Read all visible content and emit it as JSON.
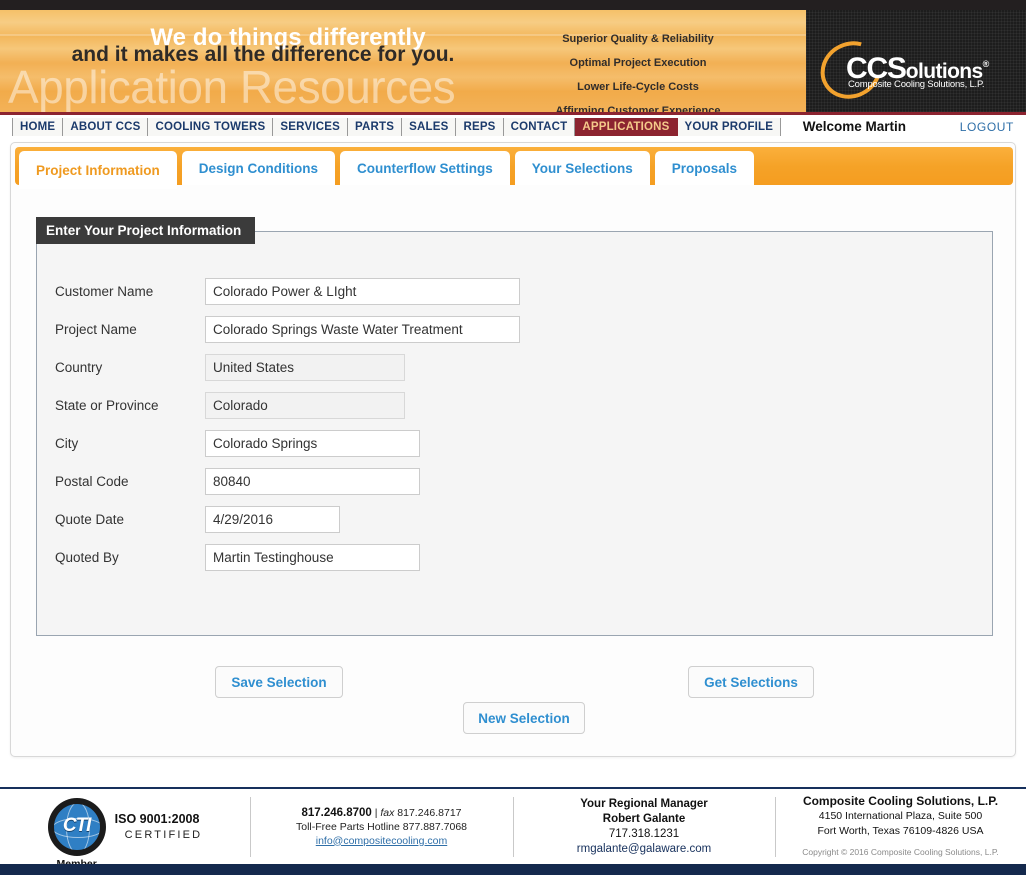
{
  "banner": {
    "headline_white": "We do things differently",
    "headline_dark": "and it makes all the difference for you.",
    "section_title": "Application Resources",
    "bullets": [
      "Superior Quality & Reliability",
      "Optimal Project Execution",
      "Lower Life-Cycle Costs",
      "Affirming Customer Experience"
    ],
    "logo": {
      "main": "CCS",
      "suffix": "olutions",
      "registered": "®",
      "subtitle": "Composite Cooling Solutions, L.P."
    }
  },
  "nav": {
    "items": [
      {
        "label": "HOME",
        "active": false
      },
      {
        "label": "ABOUT CCS",
        "active": false
      },
      {
        "label": "COOLING TOWERS",
        "active": false
      },
      {
        "label": "SERVICES",
        "active": false
      },
      {
        "label": "PARTS",
        "active": false
      },
      {
        "label": "SALES",
        "active": false
      },
      {
        "label": "REPS",
        "active": false
      },
      {
        "label": "CONTACT",
        "active": false
      },
      {
        "label": "APPLICATIONS",
        "active": true
      },
      {
        "label": "YOUR PROFILE",
        "active": false
      }
    ],
    "welcome": "Welcome Martin",
    "logout": "LOGOUT"
  },
  "tabs": [
    {
      "label": "Project Information",
      "active": true
    },
    {
      "label": "Design Conditions",
      "active": false
    },
    {
      "label": "Counterflow Settings",
      "active": false
    },
    {
      "label": "Your Selections",
      "active": false
    },
    {
      "label": "Proposals",
      "active": false
    }
  ],
  "panel": {
    "title": "Enter Your Project Information",
    "fields": [
      {
        "label": "Customer Name",
        "value": "Colorado Power & LIght",
        "readonly": false
      },
      {
        "label": "Project Name",
        "value": "Colorado Springs Waste Water Treatment",
        "readonly": false
      },
      {
        "label": "Country",
        "value": "United States",
        "readonly": true
      },
      {
        "label": "State or Province",
        "value": "Colorado",
        "readonly": true
      },
      {
        "label": "City",
        "value": "Colorado Springs",
        "readonly": false
      },
      {
        "label": "Postal Code",
        "value": "80840",
        "readonly": false
      },
      {
        "label": "Quote Date",
        "value": "4/29/2016",
        "readonly": false
      },
      {
        "label": "Quoted By",
        "value": "Martin Testinghouse",
        "readonly": false
      }
    ]
  },
  "buttons": {
    "save": "Save Selection",
    "new": "New Selection",
    "get": "Get Selections"
  },
  "footer": {
    "cti": {
      "letters": "CTI",
      "member": "Member",
      "iso": "ISO 9001:2008",
      "certified": "CERTIFIED"
    },
    "contact": {
      "phone": "817.246.8700",
      "fax_sep": " | ",
      "fax_label": "fax",
      "fax": " 817.246.8717",
      "hotline": "Toll-Free Parts Hotline 877.887.7068",
      "email": "info@compositecooling.com"
    },
    "manager": {
      "heading": "Your Regional Manager",
      "name": "Robert Galante",
      "phone": "717.318.1231",
      "email": "rmgalante@galaware.com"
    },
    "company": {
      "name": "Composite Cooling Solutions, L.P.",
      "address1": "4150 International Plaza, Suite 500",
      "address2": "Fort Worth, Texas 76109-4826 USA",
      "copyright": "Copyright © 2016 Composite Cooling Solutions, L.P."
    }
  },
  "colors": {
    "brand_orange": "#f5a227",
    "brand_maroon": "#8c2430",
    "link_blue": "#2f8fd0",
    "navy": "#14294d"
  }
}
